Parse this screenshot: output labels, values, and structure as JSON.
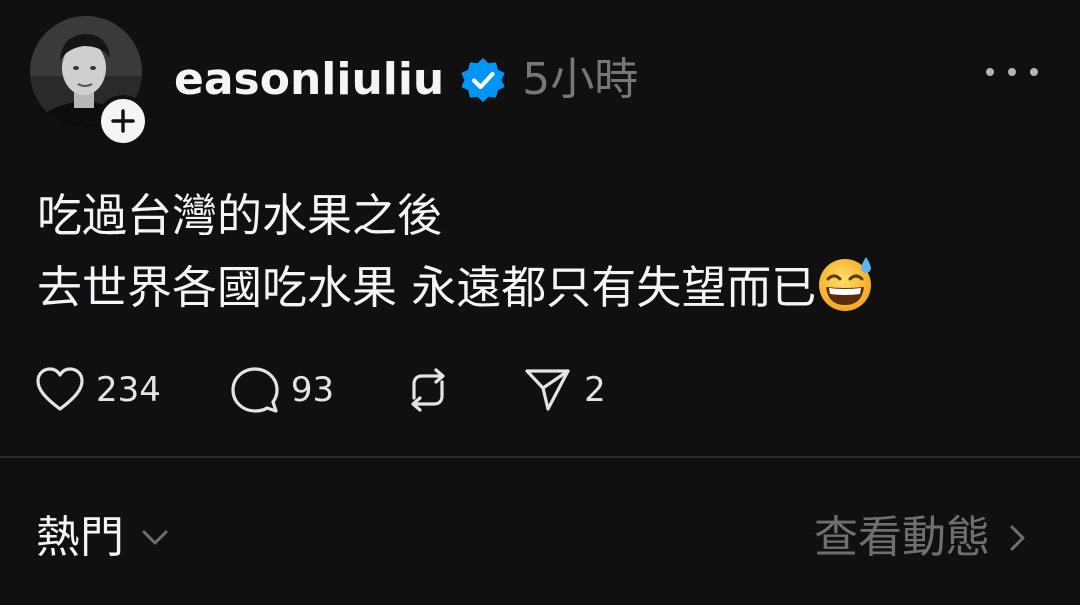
{
  "post": {
    "author": {
      "username": "easonliuliu",
      "verified": true,
      "avatar_icon": "avatar-photo",
      "follow_icon": "plus-icon"
    },
    "timestamp": "5小時",
    "menu_icon": "more-horizontal-icon",
    "content_lines": [
      "吃過台灣的水果之後",
      "去世界各國吃水果  永遠都只有失望而已"
    ],
    "content_emoji": "grinning-face-with-sweat-emoji",
    "actions": {
      "like_count": "234",
      "comment_count": "93",
      "repost_count": "",
      "share_count": "2"
    }
  },
  "replies_bar": {
    "sort_label": "熱門",
    "activity_label": "查看動態"
  },
  "colors": {
    "background": "#101010",
    "text_primary": "#f3f5f7",
    "text_secondary": "#777777",
    "verified_blue": "#0095f6",
    "divider": "#2a2a2a"
  }
}
